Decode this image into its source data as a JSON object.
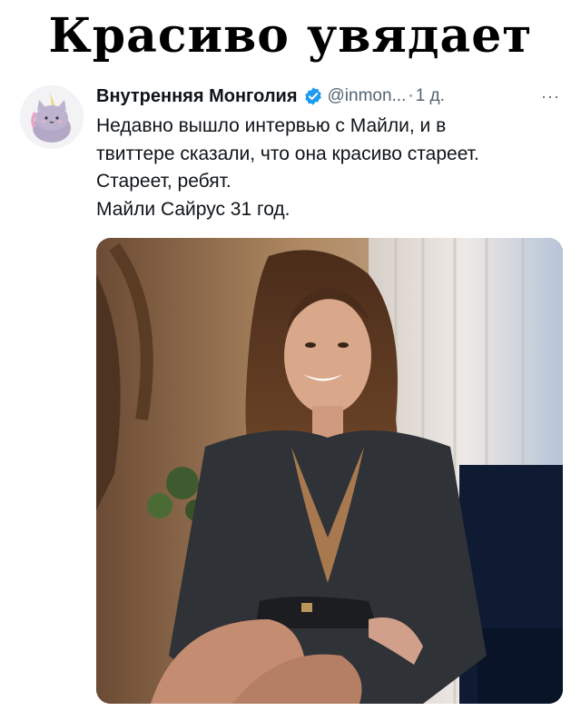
{
  "meme": {
    "title": "Красиво увядает"
  },
  "tweet": {
    "author_name": "Внутренняя Монголия",
    "handle": "@inmon...",
    "separator": "·",
    "time": "1 д.",
    "more": "···",
    "lines": [
      "Недавно вышло интервью с Майли, и в",
      "твиттере сказали, что она красиво стареет.",
      "Стареет, ребят.",
      "Майли Сайрус 31 год."
    ],
    "icons": {
      "verified": "verified-badge-icon",
      "more": "more-options-icon"
    },
    "colors": {
      "verified": "#1d9bf0",
      "secondary_text": "#536471",
      "primary_text": "#0f1419"
    }
  }
}
